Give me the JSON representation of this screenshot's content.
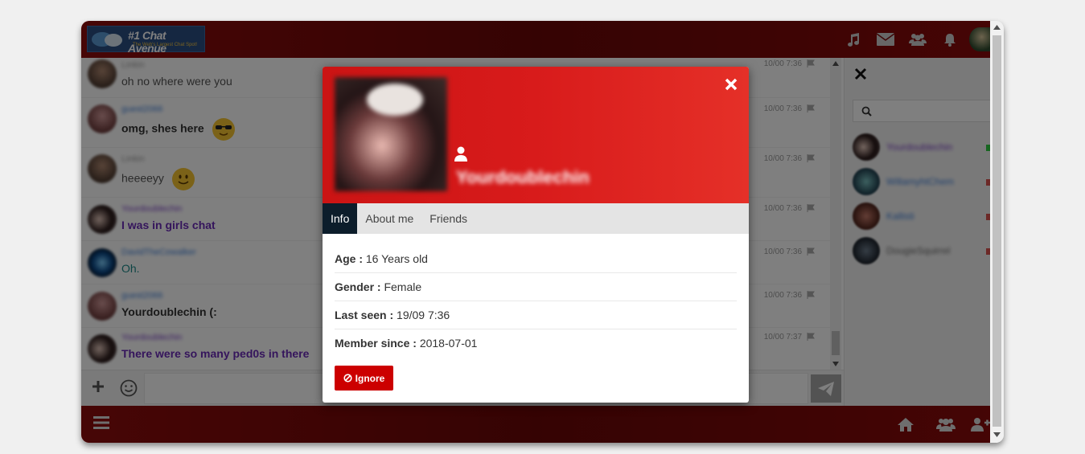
{
  "app": {
    "logo_title": "#1 Chat Avenue",
    "logo_subtitle": "The Web's Largest Chat Spot!"
  },
  "topbar": {
    "icons": [
      "music-icon",
      "envelope-icon",
      "users-icon",
      "bell-icon",
      "avatar"
    ]
  },
  "messages": [
    {
      "name": "Linkin",
      "text": "oh no where were you",
      "time": "10/00 7:36",
      "name_color": "#9a9a9a",
      "text_color": "#555555",
      "bold": false,
      "emoji": false
    },
    {
      "name": "guest2066",
      "text": "omg, shes here",
      "time": "10/00 7:36",
      "name_color": "#3b7dd8",
      "text_color": "#333333",
      "bold": true,
      "emoji": true
    },
    {
      "name": "Linkin",
      "text": "heeeeyy",
      "time": "10/00 7:36",
      "name_color": "#9a9a9a",
      "text_color": "#555555",
      "bold": false,
      "emoji": true
    },
    {
      "name": "Yourdoublechin",
      "text": "I was in girls chat",
      "time": "10/00 7:36",
      "name_color": "#7b3fc4",
      "text_color": "#6a2ab8",
      "bold": true,
      "emoji": false
    },
    {
      "name": "DavidTheCowalker",
      "text": "Oh.",
      "time": "10/00 7:36",
      "name_color": "#3b7dd8",
      "text_color": "#1d8a8a",
      "bold": false,
      "emoji": false
    },
    {
      "name": "guest2066",
      "text": "Yourdoublechin (:",
      "time": "10/00 7:36",
      "name_color": "#3b7dd8",
      "text_color": "#333333",
      "bold": true,
      "emoji": false
    },
    {
      "name": "Yourdoublechin",
      "text": "There were so many ped0s in there",
      "time": "10/00 7:37",
      "name_color": "#7b3fc4",
      "text_color": "#6a2ab8",
      "bold": true,
      "emoji": false
    }
  ],
  "input": {
    "placeholder": ""
  },
  "right_panel": {
    "search_placeholder": "",
    "users": [
      {
        "name": "Yourdoublechin",
        "color": "#7b3fc4",
        "status": "#2ecc40"
      },
      {
        "name": "WillamyhtChem",
        "color": "#3b7dd8",
        "status": "#d9534f"
      },
      {
        "name": "Kallisti",
        "color": "#3b7dd8",
        "status": "#d9534f"
      },
      {
        "name": "DougieSquirrel",
        "color": "#666666",
        "status": "#d9534f"
      }
    ]
  },
  "modal": {
    "username": "Yourdoublechin",
    "tabs": [
      "Info",
      "About me",
      "Friends"
    ],
    "active_tab": "Info",
    "info": [
      {
        "label": "Age :",
        "value": "16 Years old"
      },
      {
        "label": "Gender :",
        "value": "Female"
      },
      {
        "label": "Last seen :",
        "value": "19/09 7:36"
      },
      {
        "label": "Member since :",
        "value": "2018-07-01"
      }
    ],
    "ignore_label": "Ignore",
    "header_color": "#d81b1b",
    "button_color": "#cc0000"
  },
  "bottombar": {
    "icons": [
      "menu-icon",
      "home-icon",
      "users-icon",
      "add-user-icon"
    ]
  }
}
